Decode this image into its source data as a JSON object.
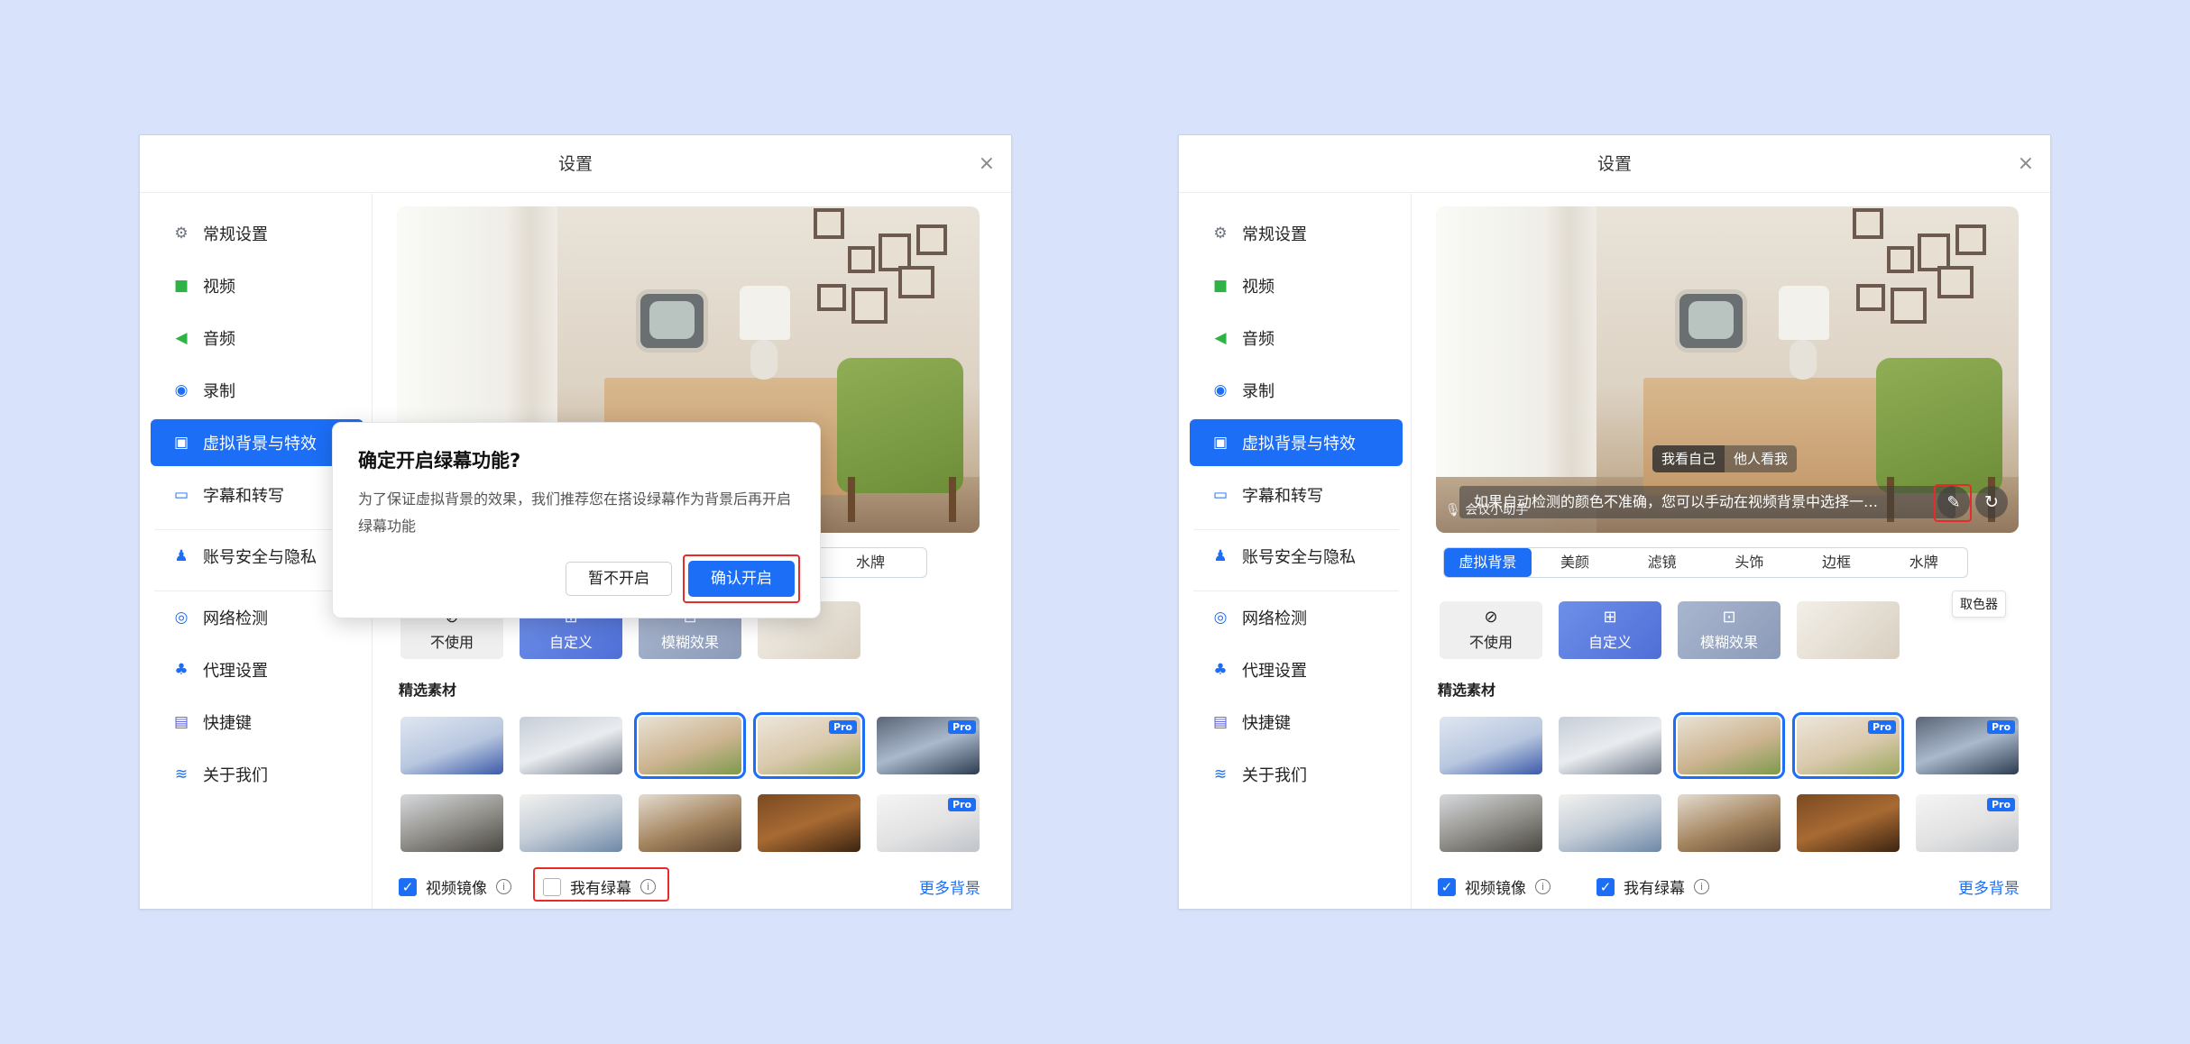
{
  "window_title": "设置",
  "close_icon": "×",
  "sidebar": [
    {
      "label": "常规设置",
      "icon": "gear-icon"
    },
    {
      "label": "视频",
      "icon": "video-camera-icon"
    },
    {
      "label": "音频",
      "icon": "speaker-icon"
    },
    {
      "label": "录制",
      "icon": "record-icon"
    },
    {
      "label": "虚拟背景与特效",
      "icon": "portrait-icon"
    },
    {
      "label": "字幕和转写",
      "icon": "caption-icon"
    },
    {
      "label": "账号安全与隐私",
      "icon": "user-lock-icon"
    },
    {
      "label": "网络检测",
      "icon": "globe-icon"
    },
    {
      "label": "代理设置",
      "icon": "network-icon"
    },
    {
      "label": "快捷键",
      "icon": "keyboard-icon"
    },
    {
      "label": "关于我们",
      "icon": "logo-icon"
    }
  ],
  "tabs": [
    "虚拟背景",
    "美颜",
    "滤镜",
    "头饰",
    "边框",
    "水牌"
  ],
  "left_visible_tabs": [
    "框",
    "水牌"
  ],
  "options": {
    "none": "不使用",
    "custom": "自定义",
    "blur": "模糊效果"
  },
  "section_title": "精选素材",
  "pro_badge": "Pro",
  "footer": {
    "mirror": "视频镜像",
    "green_screen": "我有绿幕",
    "more": "更多背景"
  },
  "dialog": {
    "title": "确定开启绿幕功能?",
    "body": "为了保证虚拟背景的效果，我们推荐您在搭设绿幕作为背景后再开启绿幕功能",
    "cancel": "暂不开启",
    "confirm": "确认开启"
  },
  "preview_overlay": {
    "view_self": "我看自己",
    "view_others": "他人看我",
    "hint": "如果自动检测的颜色不准确，您可以手动在视频背景中选择一…",
    "assistant": "会议小助手",
    "tooltip": "取色器"
  },
  "colors": {
    "accent": "#1c6ef6",
    "highlight": "#e62b2b",
    "background": "#d8e3fb"
  }
}
